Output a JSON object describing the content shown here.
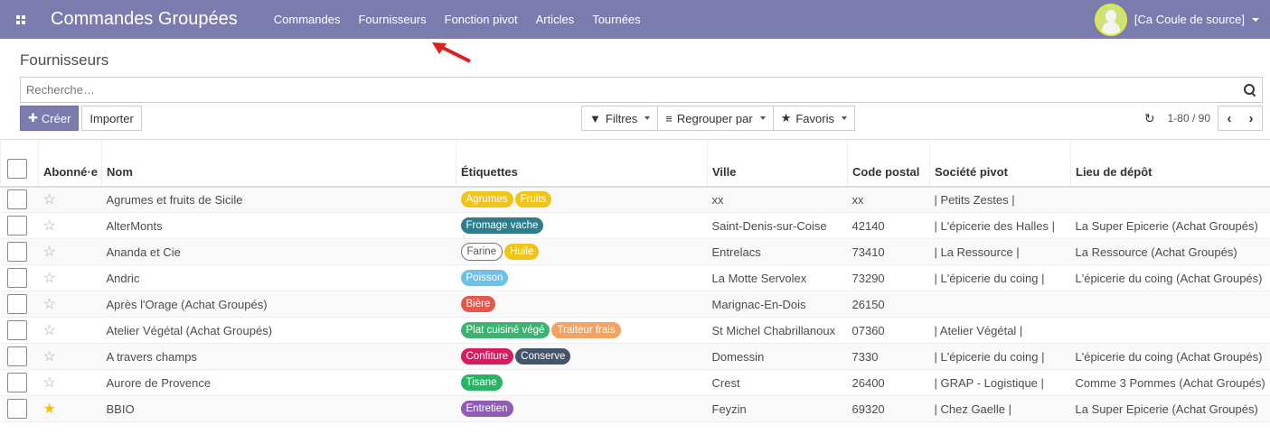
{
  "app": {
    "title": "Commandes Groupées",
    "user": "[Ca Coule de source]"
  },
  "menu": [
    "Commandes",
    "Fournisseurs",
    "Fonction pivot",
    "Articles",
    "Tournées"
  ],
  "page": {
    "title": "Fournisseurs"
  },
  "search": {
    "placeholder": "Recherche…"
  },
  "toolbar": {
    "create_label": "Créer",
    "import_label": "Importer",
    "filters_label": "Filtres",
    "group_label": "Regrouper par",
    "favorites_label": "Favoris",
    "pager_value": "1-80 / 90"
  },
  "table": {
    "headers": [
      "Abonné·e",
      "Nom",
      "Étiquettes",
      "Ville",
      "Code postal",
      "Société pivot",
      "Lieu de dépôt"
    ],
    "rows": [
      {
        "fav": false,
        "name": "Agrumes et fruits de Sicile",
        "tags": [
          {
            "t": "Agrumes",
            "c": "#f0c419"
          },
          {
            "t": "Fruits",
            "c": "#f0c419"
          }
        ],
        "city": "xx",
        "zip": "xx",
        "pivot": "| Petits Zestes |",
        "depot": ""
      },
      {
        "fav": false,
        "name": "AlterMonts",
        "tags": [
          {
            "t": "Fromage vache",
            "c": "#2e7d8c"
          }
        ],
        "city": "Saint-Denis-sur-Coise",
        "zip": "42140",
        "pivot": "| L'épicerie des Halles |",
        "depot": "La Super Epicerie (Achat Groupés)"
      },
      {
        "fav": false,
        "name": "Ananda et Cie",
        "tags": [
          {
            "t": "Farine",
            "c": "outline"
          },
          {
            "t": "Huile",
            "c": "#f0c419"
          }
        ],
        "city": "Entrelacs",
        "zip": "73410",
        "pivot": "| La Ressource |",
        "depot": "La Ressource (Achat Groupés)"
      },
      {
        "fav": false,
        "name": "Andric",
        "tags": [
          {
            "t": "Poisson",
            "c": "#6ec1e4"
          }
        ],
        "city": "La Motte Servolex",
        "zip": "73290",
        "pivot": "| L'épicerie du coing |",
        "depot": "L'épicerie du coing (Achat Groupés)"
      },
      {
        "fav": false,
        "name": "Après l'Orage (Achat Groupés)",
        "tags": [
          {
            "t": "Bière",
            "c": "#e4584b"
          }
        ],
        "city": "Marignac-En-Dois",
        "zip": "26150",
        "pivot": "",
        "depot": ""
      },
      {
        "fav": false,
        "name": "Atelier Végétal (Achat Groupés)",
        "tags": [
          {
            "t": "Plat cuisiné végé",
            "c": "#3cb371"
          },
          {
            "t": "Traiteur frais",
            "c": "#f4a261"
          }
        ],
        "city": "St Michel Chabrillanoux",
        "zip": "07360",
        "pivot": "| Atelier Végétal |",
        "depot": ""
      },
      {
        "fav": false,
        "name": "A travers champs",
        "tags": [
          {
            "t": "Confiture",
            "c": "#d81b60"
          },
          {
            "t": "Conserve",
            "c": "#44546a"
          }
        ],
        "city": "Domessin",
        "zip": "7330",
        "pivot": "| L'épicerie du coing |",
        "depot": "L'épicerie du coing (Achat Groupés)"
      },
      {
        "fav": false,
        "name": "Aurore de Provence",
        "tags": [
          {
            "t": "Tisane",
            "c": "#28b463"
          }
        ],
        "city": "Crest",
        "zip": "26400",
        "pivot": "| GRAP - Logistique |",
        "depot": "Comme 3 Pommes (Achat Groupés)"
      },
      {
        "fav": true,
        "name": "BBIO",
        "tags": [
          {
            "t": "Entretien",
            "c": "#8e5bb5"
          }
        ],
        "city": "Feyzin",
        "zip": "69320",
        "pivot": "| Chez Gaelle |",
        "depot": "La Super Epicerie (Achat Groupés)"
      }
    ]
  },
  "colors": {
    "brand": "#7c7bad",
    "star_active": "#f5c400",
    "annotation_arrow": "#e02020"
  }
}
